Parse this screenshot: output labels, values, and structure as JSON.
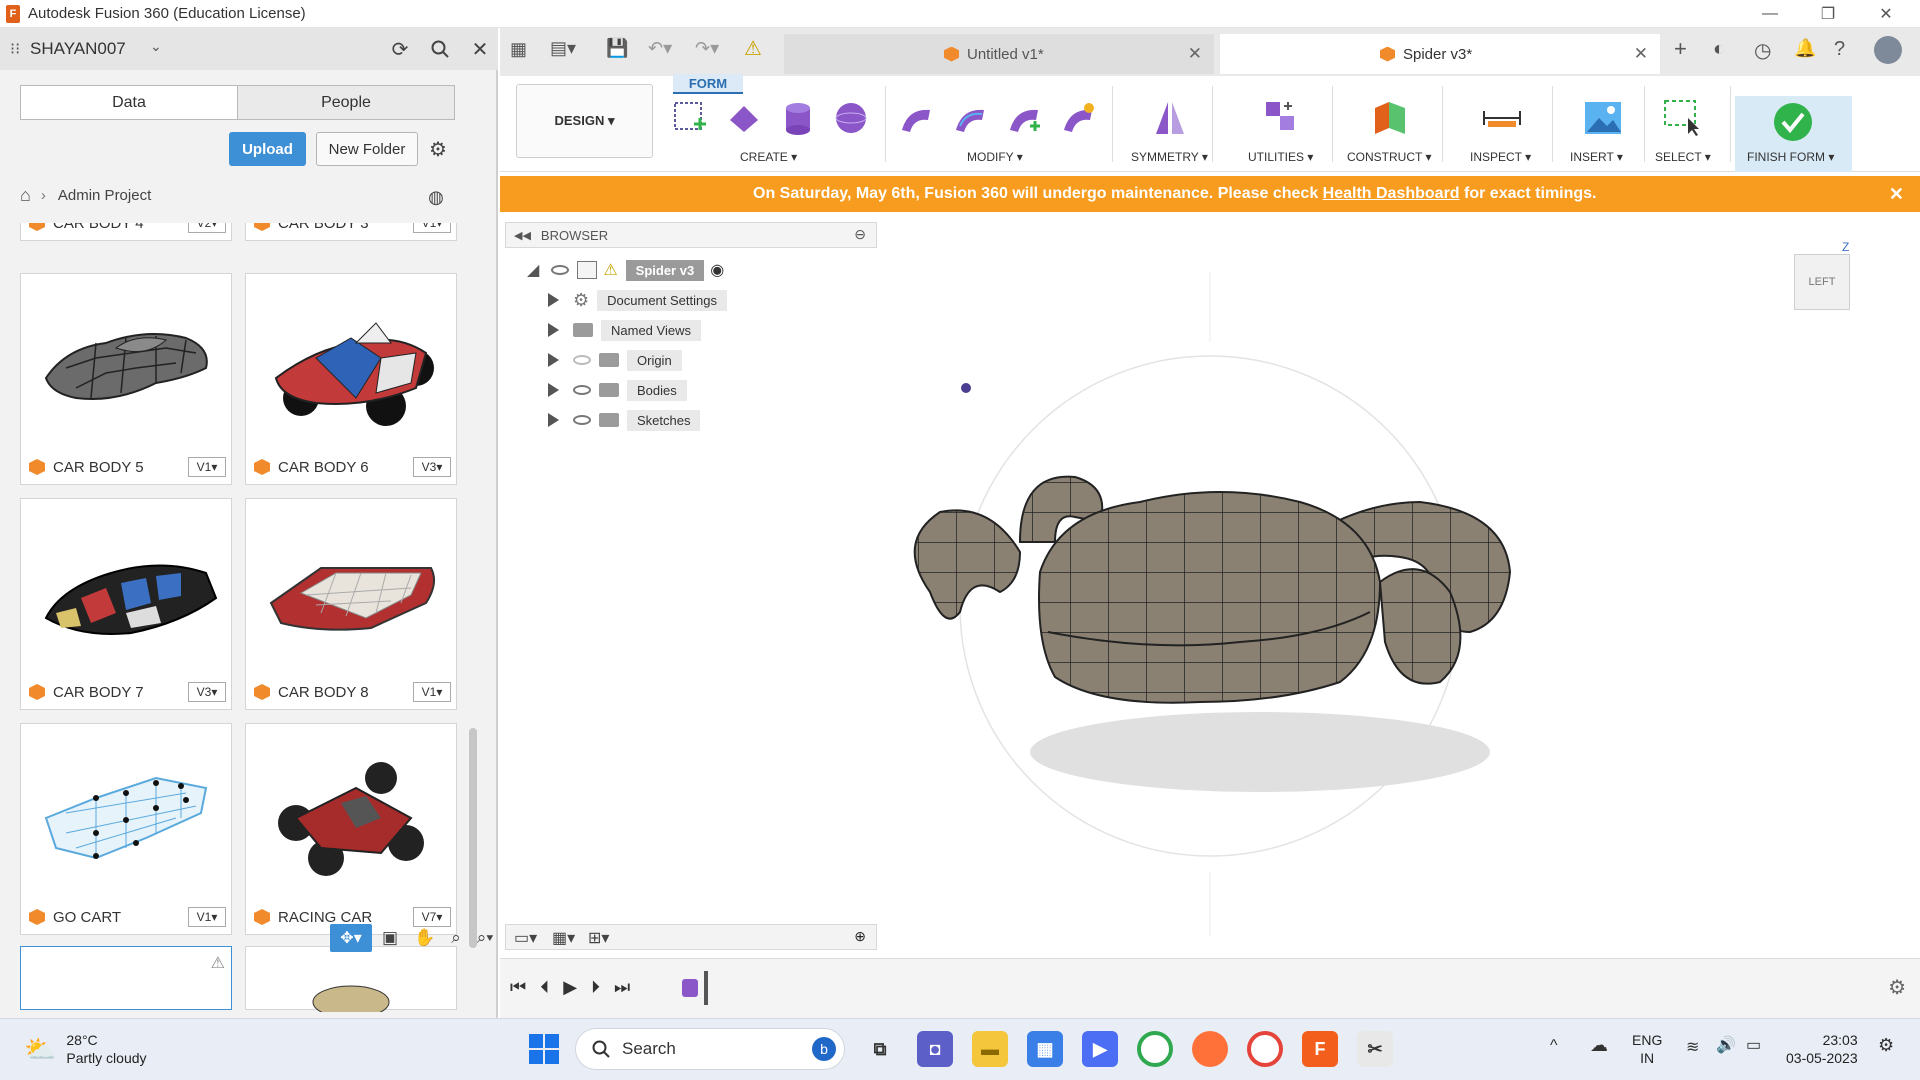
{
  "window": {
    "title": "Autodesk Fusion 360 (Education License)",
    "app_icon": "F",
    "controls": [
      "—",
      "❐",
      "✕"
    ]
  },
  "data_panel": {
    "user": "SHAYAN007",
    "tabs": [
      "Data",
      "People"
    ],
    "upload_label": "Upload",
    "new_folder_label": "New Folder",
    "breadcrumb": "Admin Project",
    "partial_top": [
      "CAR BODY 4",
      "CAR BODY 3"
    ],
    "partial_top_versions": [
      "V2▾",
      "V1▾"
    ],
    "items": [
      {
        "name": "CAR BODY 5",
        "version": "V1▾"
      },
      {
        "name": "CAR BODY 6",
        "version": "V3▾"
      },
      {
        "name": "CAR BODY 7",
        "version": "V3▾"
      },
      {
        "name": "CAR BODY 8",
        "version": "V1▾"
      },
      {
        "name": "GO CART",
        "version": "V1▾"
      },
      {
        "name": "RACING CAR",
        "version": "V7▾"
      }
    ]
  },
  "doc_tabs": [
    {
      "label": "Untitled v1*"
    },
    {
      "label": "Spider v3*"
    }
  ],
  "toolbar": {
    "workspace": "DESIGN ▾",
    "active_tab": "FORM",
    "groups": [
      "CREATE ▾",
      "MODIFY ▾",
      "SYMMETRY ▾",
      "UTILITIES ▾",
      "CONSTRUCT ▾",
      "INSPECT ▾",
      "INSERT ▾",
      "SELECT ▾",
      "FINISH FORM ▾"
    ]
  },
  "banner": {
    "prefix": "On Saturday, May 6th, Fusion 360 will undergo maintenance. Please check ",
    "link": "Health Dashboard",
    "suffix": " for exact timings.",
    "close": "✕"
  },
  "browser": {
    "title": "BROWSER",
    "root": "Spider v3",
    "nodes": [
      "Document Settings",
      "Named Views",
      "Origin",
      "Bodies",
      "Sketches"
    ]
  },
  "viewcube": {
    "face": "LEFT",
    "axis_z": "Z"
  },
  "taskbar": {
    "temperature": "28°C",
    "condition": "Partly cloudy",
    "search_label": "Search",
    "lang_1": "ENG",
    "lang_2": "IN",
    "time": "23:03",
    "date": "03-05-2023"
  },
  "colors": {
    "accent": "#3d8fd6",
    "banner": "#f79c1e",
    "fusion_orange": "#f08a2b",
    "finish_green": "#2fb34a"
  }
}
